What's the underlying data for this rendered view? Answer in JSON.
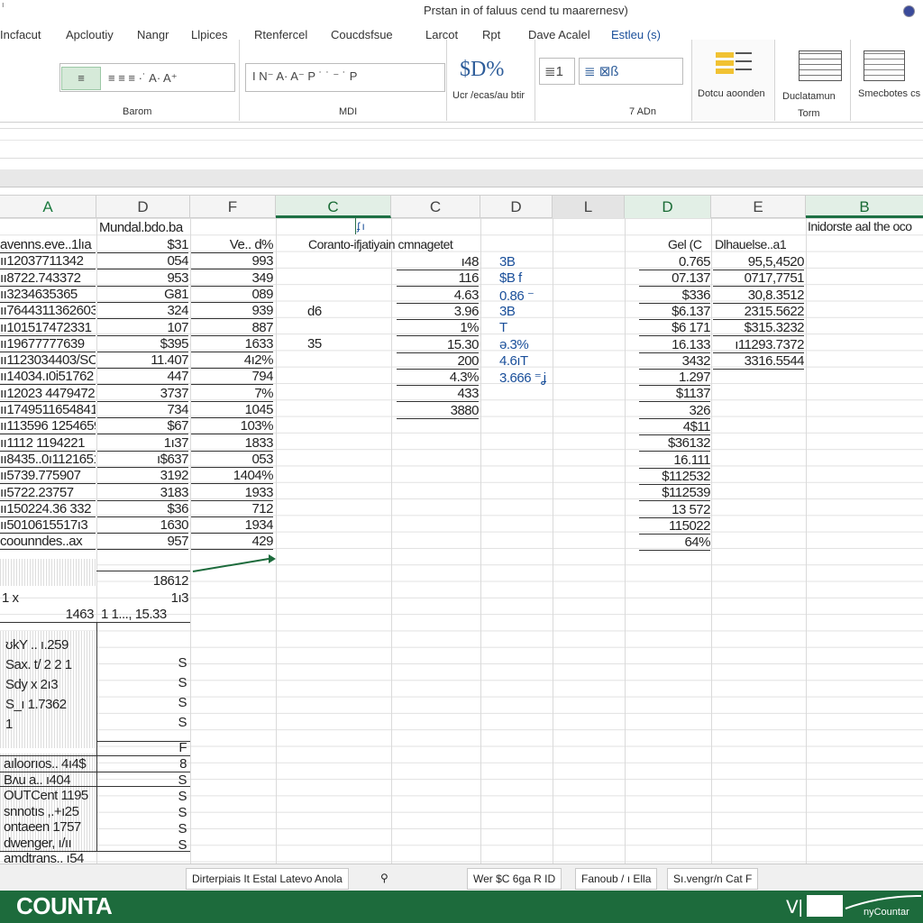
{
  "window": {
    "title": "Prstan in of faluus cend tu maarernesv)",
    "small": "ı"
  },
  "menu": [
    "Incfacut",
    "Apcloutiy",
    "Nangr",
    "Llpices",
    "Rtenfercel",
    "Coucdsfsue",
    "Larcot",
    "Rpt",
    "Dave Acalel",
    "Estleu (s)"
  ],
  "ribbon": {
    "group1": {
      "label": "Barom",
      "row1": "≡ ≡ ≡ ·˙ A· A⁺",
      "btn_a": "≡",
      "btn_b": "≡"
    },
    "group2": {
      "label": "MDI",
      "row1": "I   N⁻ A· A⁻ P  ˙ ˙ ⁻ ˙  P"
    },
    "group3": {
      "label": "Ucr /ecas/au btir",
      "big": "$D%"
    },
    "group4": {
      "label": "7 ADn",
      "a": "≣1",
      "b": "≣ ⊠ß"
    },
    "group5": {
      "label": "Dotcu aoonden"
    },
    "group6": {
      "label": "Duclatamun\nTorm"
    },
    "group7": {
      "label": "Smecbotes cs"
    }
  },
  "columns": [
    {
      "label": "A",
      "state": "selg"
    },
    {
      "label": "D",
      "state": ""
    },
    {
      "label": "F",
      "state": ""
    },
    {
      "label": "C",
      "state": "sel"
    },
    {
      "label": "C",
      "state": ""
    },
    {
      "label": "D",
      "state": ""
    },
    {
      "label": "L",
      "state": ""
    },
    {
      "label": "D",
      "state": "sel"
    },
    {
      "label": "E",
      "state": ""
    },
    {
      "label": "B",
      "state": "sel"
    }
  ],
  "sheet": {
    "b_header": "Mundal.bdo.ba",
    "col_a": [
      "avenns.eve..1lıa",
      "ıı12037711342",
      "ıı8722.743372",
      "ıı3234635365",
      "ıı7644311362603",
      "ıı101517472331",
      "ıı19677777639",
      "ıı1123034403/SO",
      "ıı14034.ı0i51762",
      "ıı12023 4479472",
      "ıı1749511654841",
      "ıı113596 12546591",
      "ıı1112 1194221",
      "ıı8435..0ı1121651",
      "ıı5739.775907",
      "ıı5722.23757",
      "ıı150224.36 332",
      "ıı5010615517ı3",
      "coounndes..ax"
    ],
    "col_b": [
      "$31",
      "054",
      "953",
      "G81",
      "324",
      "107",
      "$395",
      "11.407",
      "447",
      "3737",
      "734",
      "$67",
      "1ı37",
      "ı$637",
      "3192",
      "3183",
      "$36",
      "1630",
      "957"
    ],
    "col_c": [
      "Ve.. d%",
      "993",
      "349",
      "089",
      "939",
      "887",
      "1633",
      "4ı2%",
      "794",
      "7%",
      "1045",
      "103%",
      "1833",
      "053",
      "1404%",
      "1933",
      "712",
      "1934",
      "429"
    ],
    "c_header": "Coranto-ifjatiyain cmnagetet",
    "c_extra": [
      "d6",
      "35"
    ],
    "col_e_top": "ʄ  ı",
    "col_e": [
      "ı48",
      "116",
      "4.63",
      "3.96",
      "1%",
      "15.30",
      "200",
      "4.3%",
      "433",
      "3880"
    ],
    "col_f": [
      "3B",
      "$B  f",
      "0.86  ⁻",
      "3B",
      "T",
      "ə.3%",
      "4.6ıT",
      "3.666 ⁼ʝ"
    ],
    "col_l_header": "Gel (C",
    "col_l": [
      "0.765",
      "07.137",
      "$336",
      "$6.137",
      "$6 171",
      "16.133",
      "3432",
      "1.297",
      "$1137",
      "326",
      "4$11",
      "$36132",
      "16.111",
      "$112532",
      "$112539",
      "13 572",
      "115022",
      "64%"
    ],
    "col_m_header": "Dlhauelse..a1",
    "col_m": [
      "95,5,4520",
      "0717,7751",
      "30,8.3512",
      "2315.5622",
      "$315.3232",
      "ı11293.7372",
      "3316.5544"
    ],
    "col_n_header": "Inidorste aal the oco",
    "sum": {
      "b1": "18612",
      "b2": "1ı3",
      "a3": "1 x",
      "a3b": "1463",
      "b3": "1 1...,  15.33"
    },
    "lower_a": [
      "ʊkY ..  ı.259",
      "Sax. t/ 2 2 1",
      "Sdy x 2ı3",
      "S_ı  1.7362",
      "1"
    ],
    "lower_a2": [
      "aıloorıos.. 4ı4$",
      "Bʌu a.. ı404",
      "OUTCent 1195",
      "snnotıs ,.+ı25",
      "ontaeen 1757",
      "dwenger, ı/ıı",
      "amdtrans.. ı54"
    ],
    "lower_b": [
      "S",
      "S",
      "S",
      "S"
    ],
    "lower_b2": [
      "F",
      "8",
      "S",
      "S",
      "S",
      "S",
      "S"
    ]
  },
  "sheet_tabs": [
    "Dirterpiais  It  Estal  Latevo Anola",
    "⚲",
    "Wer $C 6ga  R  ID",
    "Fanoub  / ı Ella",
    "Sı.vengr/n Cat F"
  ],
  "status": {
    "name": "COUNTA",
    "right": "nyCountar"
  }
}
